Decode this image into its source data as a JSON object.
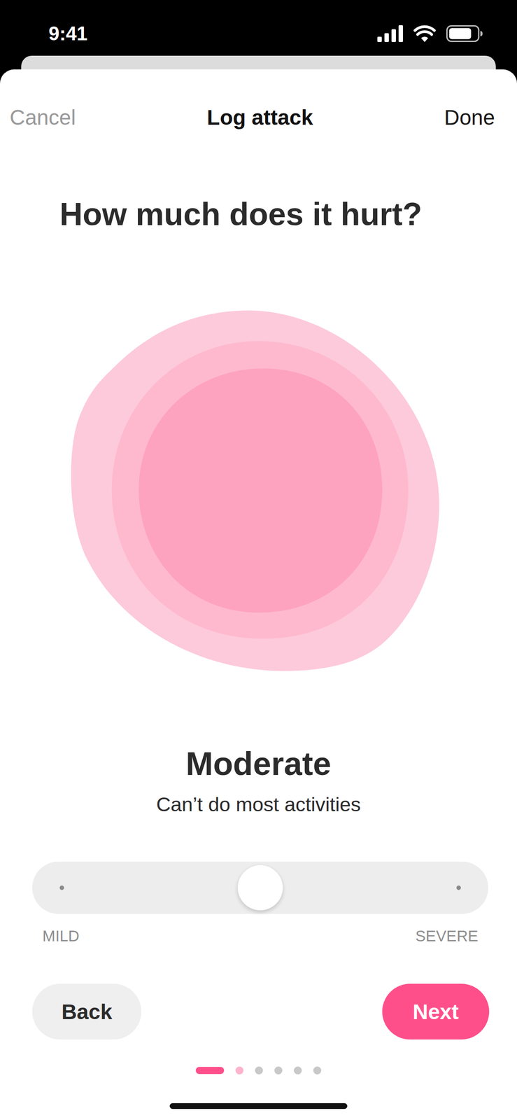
{
  "status_bar": {
    "time": "9:41",
    "battery_level": 0.8
  },
  "nav": {
    "cancel": "Cancel",
    "title": "Log attack",
    "done": "Done"
  },
  "question": "How much does it hurt?",
  "severity": {
    "label": "Moderate",
    "description": "Can’t do most activities"
  },
  "slider": {
    "level": 0.5,
    "min_label": "MILD",
    "max_label": "SEVERE"
  },
  "buttons": {
    "back": "Back",
    "next": "Next"
  },
  "pager": [
    {
      "selected": true,
      "highlighted": false
    },
    {
      "selected": false,
      "highlighted": true
    },
    {
      "selected": false,
      "highlighted": false
    },
    {
      "selected": false,
      "highlighted": false
    },
    {
      "selected": false,
      "highlighted": false
    },
    {
      "selected": false,
      "highlighted": false
    }
  ]
}
